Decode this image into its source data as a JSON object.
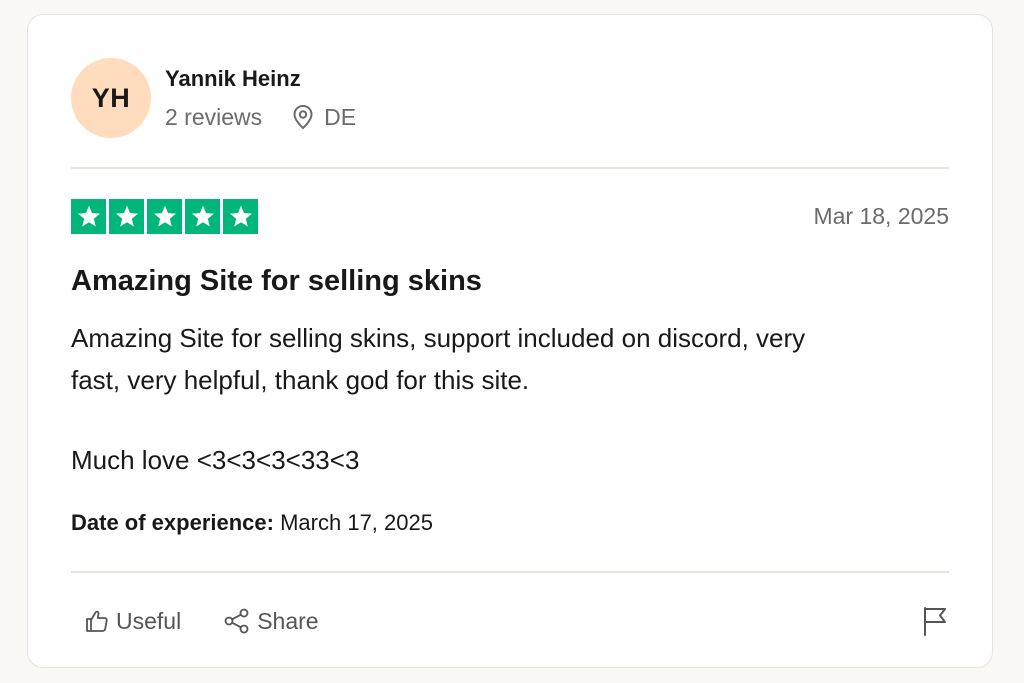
{
  "reviewer": {
    "initials": "YH",
    "name": "Yannik Heinz",
    "reviews": "2 reviews",
    "country": "DE",
    "avatar_color": "#ffdcbd"
  },
  "rating": {
    "stars": 5,
    "max_stars": 5,
    "star_color": "#00b67a",
    "date": "Mar 18, 2025"
  },
  "review": {
    "title": "Amazing Site for selling skins",
    "body_line1": "Amazing Site for selling skins, support included on discord, very",
    "body_line2": "fast, very helpful, thank god for this site.",
    "body_line3": "Much love <3<3<3<33<3",
    "experience_label": "Date of experience:",
    "experience_date": "March 17, 2025"
  },
  "actions": {
    "useful_label": "Useful",
    "share_label": "Share",
    "icons": [
      "thumbs-up-icon",
      "share-icon",
      "flag-icon"
    ]
  }
}
